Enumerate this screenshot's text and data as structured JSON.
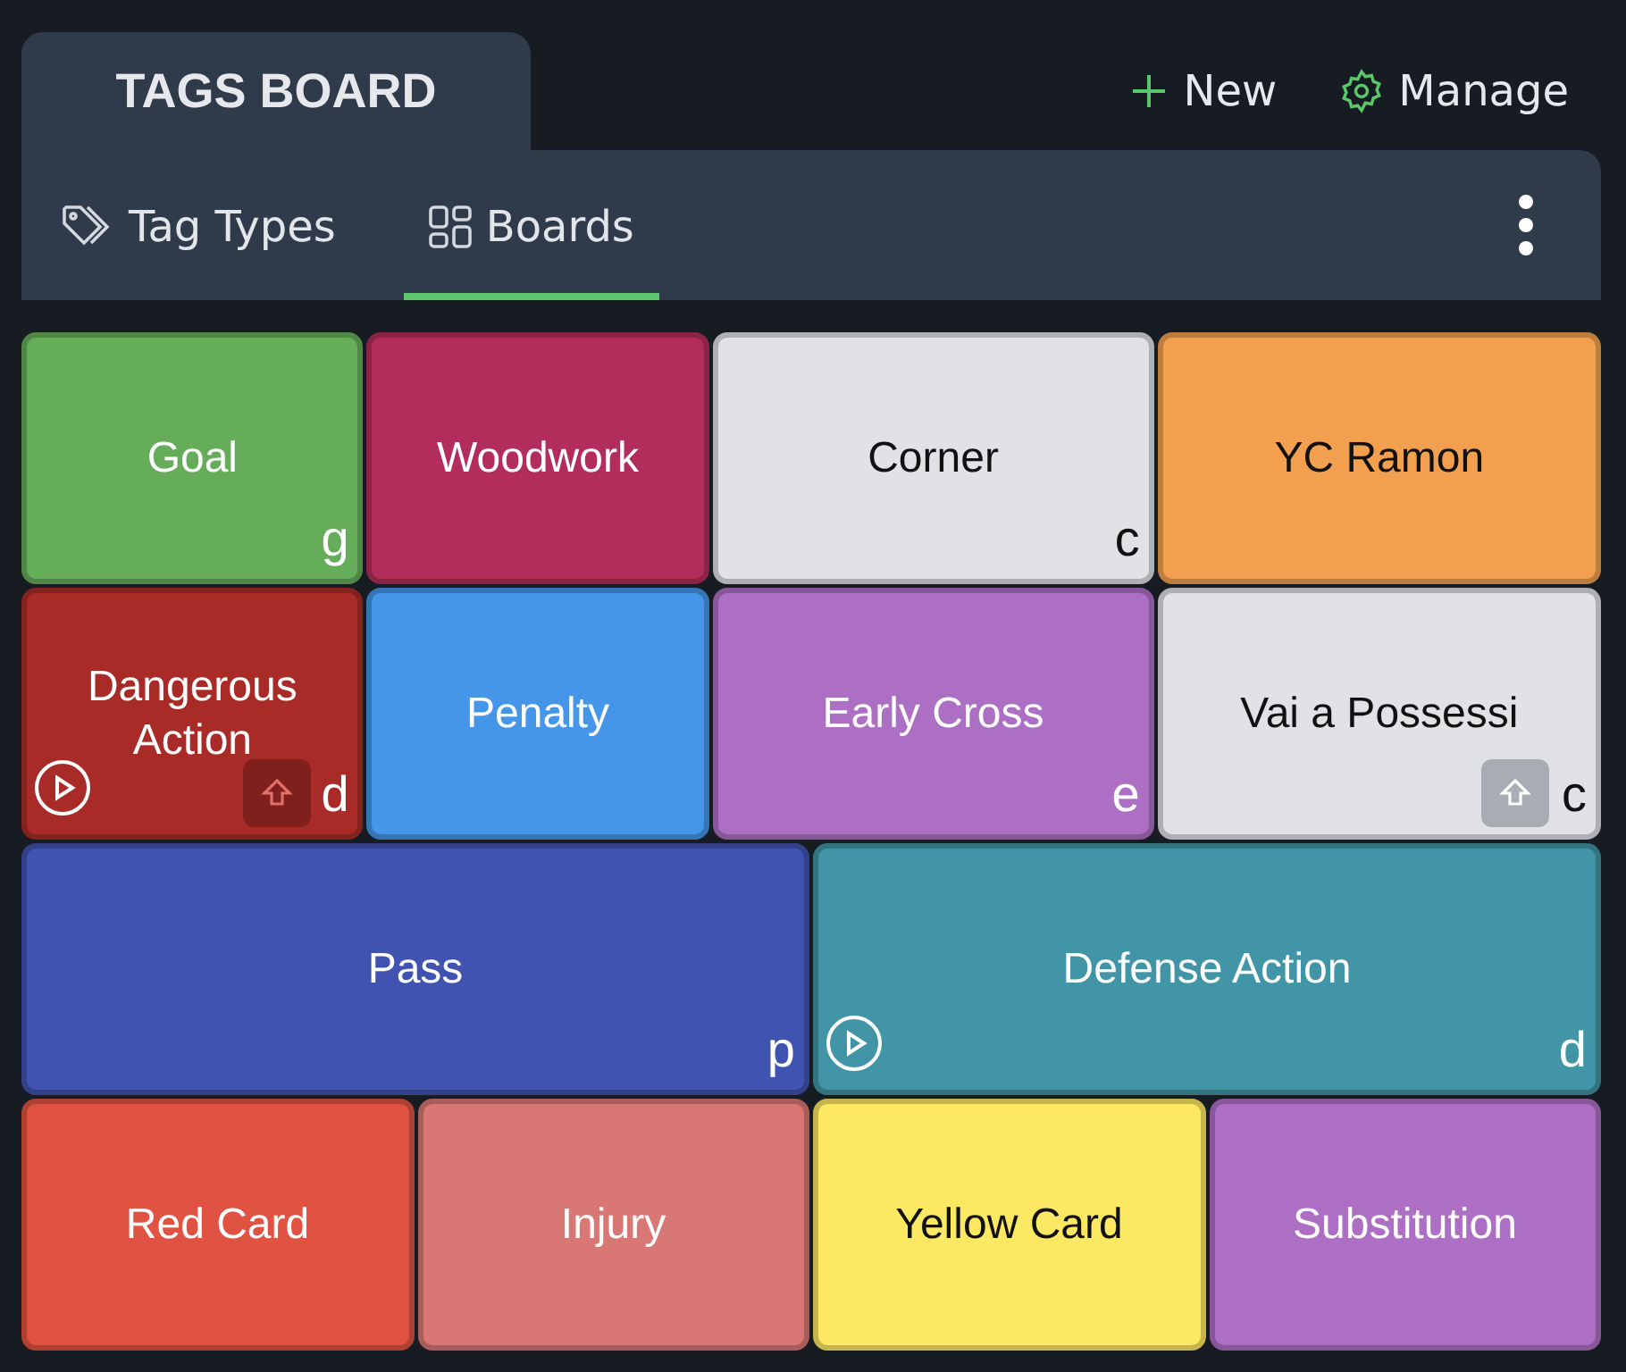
{
  "header": {
    "title": "TAGS BOARD",
    "actions": [
      {
        "kind": "new",
        "label": "New"
      },
      {
        "kind": "manage",
        "label": "Manage"
      }
    ]
  },
  "tabs": [
    {
      "kind": "tag",
      "label": "Tag Types",
      "selected": false
    },
    {
      "kind": "grid",
      "label": "Boards",
      "selected": true
    }
  ],
  "board": {
    "rows": [
      {
        "tiles": [
          {
            "label": "Goal",
            "color": "#66ad5a",
            "hotkey": "g"
          },
          {
            "label": "Woodwork",
            "color": "#b22d5b"
          },
          {
            "label": "Corner",
            "color": "#e0e2e6",
            "hotkey": "c"
          },
          {
            "label": "YC Ramon",
            "color": "#f2a04f"
          }
        ]
      },
      {
        "tiles": [
          {
            "label": "Dangerous Action",
            "color": "#a92b27",
            "hotkey": "d",
            "playable": true,
            "shift": true
          },
          {
            "label": "Penalty",
            "color": "#4596e8"
          },
          {
            "label": "Early Cross",
            "color": "#ad6fc4",
            "hotkey": "e"
          },
          {
            "label": "Vai a Possessi",
            "color": "#e0e2e6",
            "hotkey": "c",
            "shift": true
          }
        ]
      },
      {
        "tiles": [
          {
            "label": "Pass",
            "color": "#4053b0",
            "hotkey": "p"
          },
          {
            "label": "Defense Action",
            "color": "#4295a6",
            "hotkey": "d",
            "playable": true
          }
        ]
      },
      {
        "tiles": [
          {
            "label": "Red Card",
            "color": "#e05342"
          },
          {
            "label": "Injury",
            "color": "#d87773"
          },
          {
            "label": "Yellow Card",
            "color": "#fce862"
          },
          {
            "label": "Substitution",
            "color": "#ad6fc4"
          }
        ]
      }
    ]
  }
}
